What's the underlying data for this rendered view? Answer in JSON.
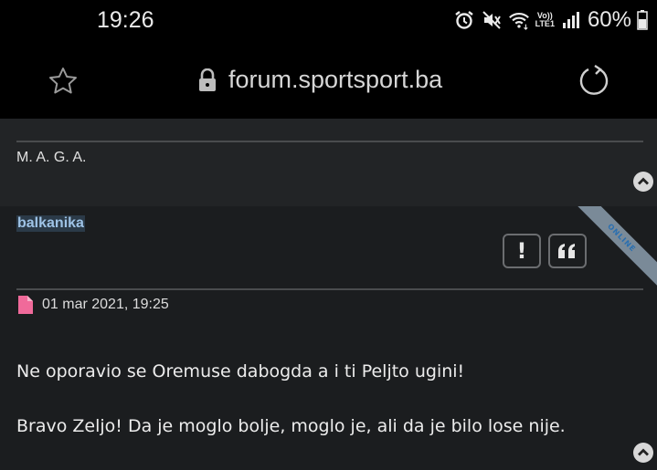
{
  "status_bar": {
    "time": "19:26",
    "network_label_top": "Vo))",
    "network_label_bottom": "LTE1",
    "battery_percent": "60%"
  },
  "browser": {
    "url": "forum.sportsport.ba"
  },
  "post_prev": {
    "signature": "M. A. G. A."
  },
  "post": {
    "username": "balkanika",
    "online_ribbon": "ONLINE",
    "report_label": "!",
    "date": "01 mar 2021, 19:25",
    "lines": [
      "Ne oporavio se Oremuse dabogda a i ti Peljto ugini!",
      "Bravo Zeljo! Da je moglo bolje, moglo je, ali da je bilo lose nije."
    ]
  },
  "colors": {
    "username": "#9ec3e6",
    "ribbon": "#7a8a98",
    "doc_icon": "#f06a9a"
  }
}
